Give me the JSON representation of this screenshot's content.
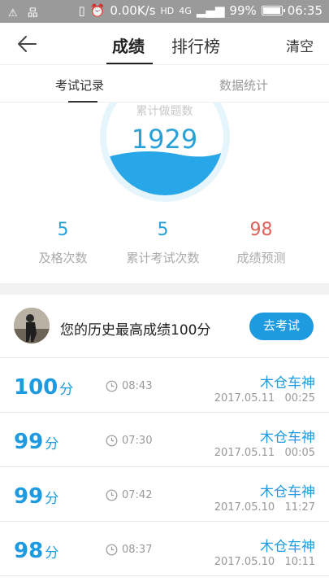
{
  "status_bar": {
    "left_icons": "⚠ 品",
    "net_speed": "0.00K/s",
    "hd": "HD",
    "signal": "4G",
    "battery": "99%",
    "time": "06:35",
    "battery_level": 0.99
  },
  "nav": {
    "tab_scores": "成绩",
    "tab_ranking": "排行榜",
    "clear": "清空"
  },
  "subtabs": {
    "records": "考试记录",
    "stats": "数据统计"
  },
  "gauge": {
    "label": "累计做题数",
    "value": "1929"
  },
  "stats": [
    {
      "value": "5",
      "label": "及格次数",
      "color": "#2aa0d8"
    },
    {
      "value": "5",
      "label": "累计考试次数",
      "color": "#2aa0d8"
    },
    {
      "value": "98",
      "label": "成绩预测",
      "color": "#e0605a"
    }
  ],
  "best": {
    "text": "您的历史最高成绩100分",
    "button": "去考试"
  },
  "records": [
    {
      "score": "100",
      "unit": "分",
      "duration": "08:43",
      "name": "木仓车神",
      "date": "2017.05.11   00:25"
    },
    {
      "score": "99",
      "unit": "分",
      "duration": "07:30",
      "name": "木仓车神",
      "date": "2017.05.11   00:05"
    },
    {
      "score": "99",
      "unit": "分",
      "duration": "07:42",
      "name": "木仓车神",
      "date": "2017.05.10   11:27"
    },
    {
      "score": "98",
      "unit": "分",
      "duration": "08:37",
      "name": "木仓车神",
      "date": "2017.05.10   10:11"
    }
  ],
  "colors": {
    "accent": "#1e9be0",
    "red": "#e0605a"
  }
}
